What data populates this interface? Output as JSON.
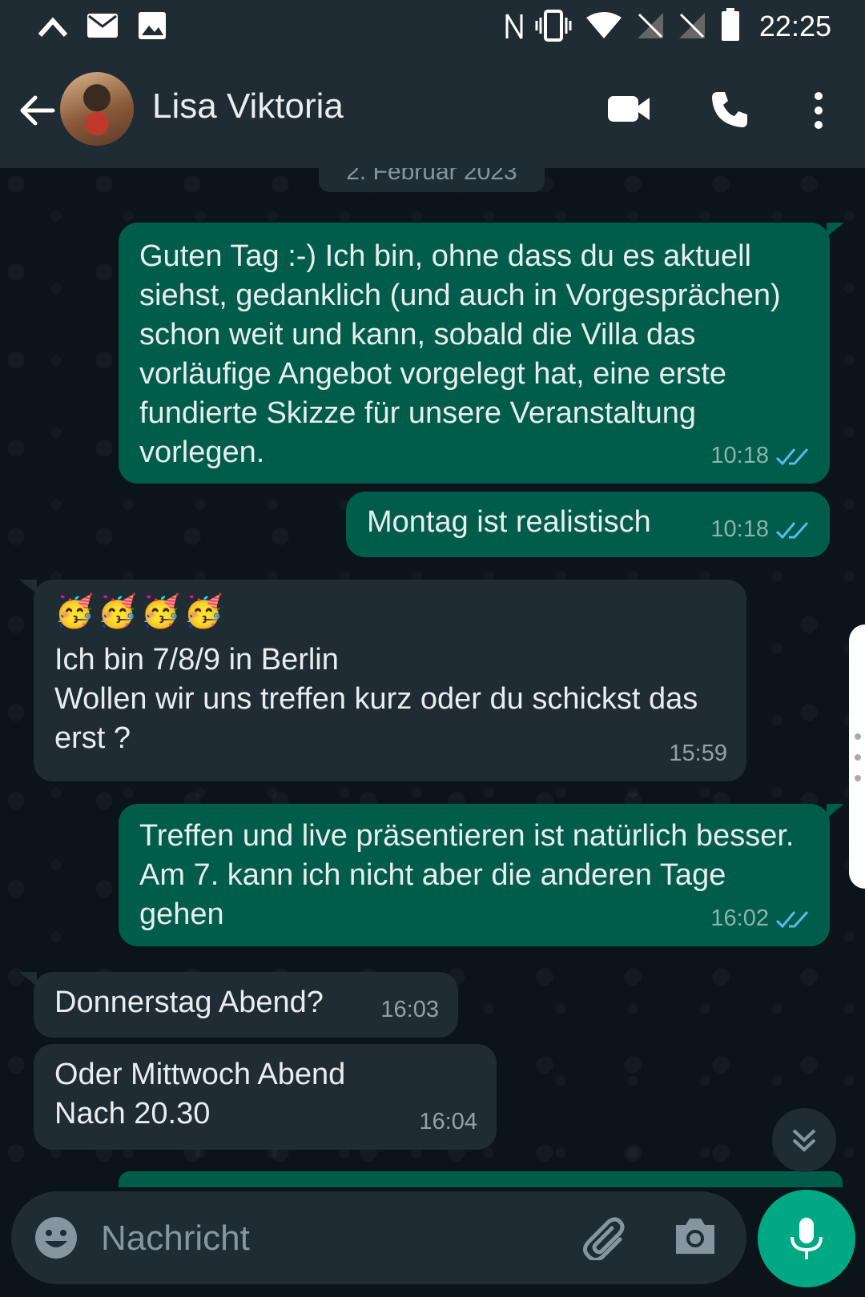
{
  "status_bar": {
    "time": "22:25"
  },
  "header": {
    "contact_name": "Lisa Viktoria"
  },
  "chat": {
    "date_chip": "2. Februar 2023",
    "messages": [
      {
        "direction": "out",
        "text": "Guten Tag :-) Ich bin, ohne dass du es aktuell siehst, gedanklich (und auch in Vorgesprächen) schon weit und kann, sobald die Villa das vorläufige Angebot vorgelegt hat, eine erste fundierte Skizze für unsere Veranstaltung vorlegen.",
        "time": "10:18"
      },
      {
        "direction": "out",
        "text": "Montag ist realistisch",
        "time": "10:18"
      },
      {
        "direction": "in",
        "emojis": "🥳🥳🥳🥳",
        "text": "Ich bin 7/8/9 in Berlin\nWollen wir uns treffen kurz oder du schickst das erst ?",
        "time": "15:59"
      },
      {
        "direction": "out",
        "text": "Treffen und live präsentieren ist natürlich besser. Am 7. kann ich nicht aber die anderen Tage gehen",
        "time": "16:02"
      },
      {
        "direction": "in",
        "text": "Donnerstag Abend?",
        "time": "16:03"
      },
      {
        "direction": "in",
        "text": "Oder Mittwoch Abend\nNach 20.30",
        "time": "16:04"
      }
    ]
  },
  "input": {
    "placeholder": "Nachricht"
  },
  "colors": {
    "outgoing_bubble": "#005c4b",
    "incoming_bubble": "#1f2c34",
    "accent": "#00a884",
    "read_ticks": "#53bdeb"
  }
}
